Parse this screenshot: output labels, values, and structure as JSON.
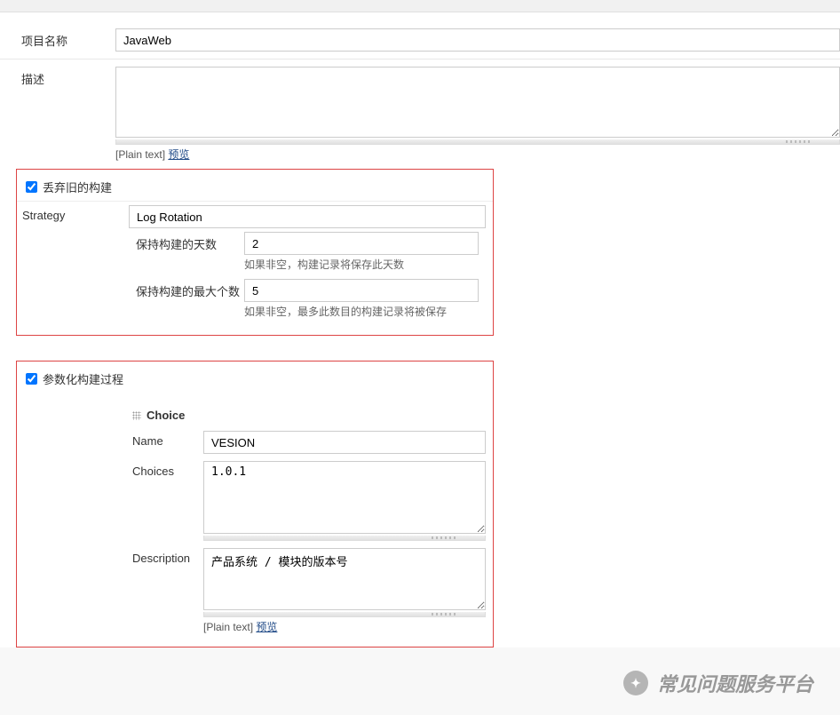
{
  "project": {
    "name_label": "项目名称",
    "name_value": "JavaWeb",
    "desc_label": "描述",
    "desc_value": "",
    "plain_text": "[Plain text]",
    "preview": "预览"
  },
  "discard": {
    "checkbox_label": "丢弃旧的构建",
    "strategy_label": "Strategy",
    "strategy_value": "Log Rotation",
    "days_label": "保持构建的天数",
    "days_value": "2",
    "days_hint": "如果非空，构建记录将保存此天数",
    "max_label": "保持构建的最大个数",
    "max_value": "5",
    "max_hint": "如果非空，最多此数目的构建记录将被保存"
  },
  "parametrize": {
    "checkbox_label": "参数化构建过程",
    "choice_header": "Choice",
    "name_label": "Name",
    "name_value": "VESION",
    "choices_label": "Choices",
    "choices_value": "1.0.1",
    "description_label": "Description",
    "description_value": "产品系统 / 模块的版本号",
    "plain_text": "[Plain text]",
    "preview": "预览"
  },
  "watermark": {
    "text": "常见问题服务平台"
  }
}
